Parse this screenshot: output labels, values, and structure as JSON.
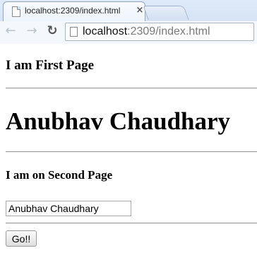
{
  "browser": {
    "tab_title": "localhost:2309/index.html",
    "tab_close": "×",
    "url_host": "localhost",
    "url_rest": ":2309/index.html",
    "icons": {
      "back": "back-arrow-icon",
      "forward": "forward-arrow-icon",
      "reload": "reload-icon",
      "favicon": "page-icon",
      "close": "close-icon"
    },
    "back_glyph": "←",
    "forward_glyph": "→",
    "reload_glyph": "↻"
  },
  "page": {
    "first_heading": "I am First Page",
    "name_heading": "Anubhav Chaudhary",
    "second_heading": "I am on Second Page",
    "name_input_value": "Anubhav Chaudhary",
    "go_button": "Go!!"
  }
}
